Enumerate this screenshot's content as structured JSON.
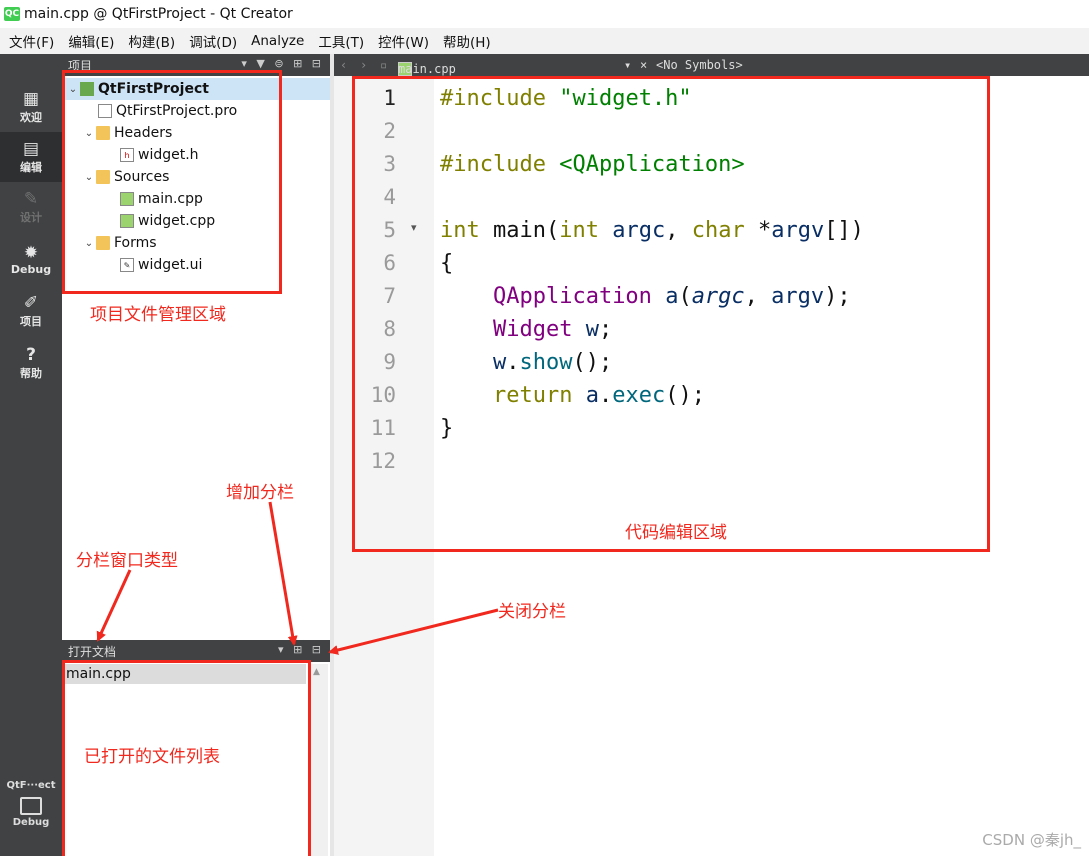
{
  "window": {
    "title": "main.cpp @ QtFirstProject - Qt Creator",
    "logo": "QC"
  },
  "menu": [
    "文件(F)",
    "编辑(E)",
    "构建(B)",
    "调试(D)",
    "Analyze",
    "工具(T)",
    "控件(W)",
    "帮助(H)"
  ],
  "modes": [
    {
      "label": "欢迎",
      "icon": "grid-icon",
      "glyph": "▦"
    },
    {
      "label": "编辑",
      "icon": "edit-icon",
      "glyph": "▤"
    },
    {
      "label": "设计",
      "icon": "pen-icon",
      "glyph": "✎"
    },
    {
      "label": "Debug",
      "icon": "bug-icon",
      "glyph": "✹"
    },
    {
      "label": "项目",
      "icon": "wrench-icon",
      "glyph": "✐"
    },
    {
      "label": "帮助",
      "icon": "help-icon",
      "glyph": "?"
    }
  ],
  "kit": {
    "project": "QtF···ect",
    "build": "Debug"
  },
  "project_pane": {
    "header": "项目",
    "tree": [
      {
        "label": "QtFirstProject",
        "depth": 0,
        "expanded": true,
        "icon": "project-icon"
      },
      {
        "label": "QtFirstProject.pro",
        "depth": 1,
        "icon": "pro-file-icon"
      },
      {
        "label": "Headers",
        "depth": 1,
        "expanded": true,
        "icon": "folder-icon"
      },
      {
        "label": "widget.h",
        "depth": 2,
        "icon": "header-file-icon"
      },
      {
        "label": "Sources",
        "depth": 1,
        "expanded": true,
        "icon": "folder-icon"
      },
      {
        "label": "main.cpp",
        "depth": 2,
        "icon": "cpp-file-icon"
      },
      {
        "label": "widget.cpp",
        "depth": 2,
        "icon": "cpp-file-icon"
      },
      {
        "label": "Forms",
        "depth": 1,
        "expanded": true,
        "icon": "folder-icon"
      },
      {
        "label": "widget.ui",
        "depth": 2,
        "icon": "ui-file-icon"
      }
    ]
  },
  "open_docs": {
    "header": "打开文档",
    "items": [
      "main.cpp"
    ]
  },
  "editor": {
    "file": "main.cpp",
    "symbols": "<No Symbols>",
    "current_line": 1,
    "lines": [
      "1",
      "2",
      "3",
      "4",
      "5",
      "6",
      "7",
      "8",
      "9",
      "10",
      "11",
      "12"
    ]
  },
  "annotations": {
    "project_area": "项目文件管理区域",
    "code_area": "代码编辑区域",
    "add_split": "增加分栏",
    "split_type": "分栏窗口类型",
    "close_split": "关闭分栏",
    "open_list": "已打开的文件列表"
  },
  "watermark": "CSDN @秦jh_",
  "colors": {
    "annotation": "#f0281e",
    "sidebar": "#404244",
    "keyword": "#808000",
    "string": "#008000",
    "type": "#800080"
  }
}
